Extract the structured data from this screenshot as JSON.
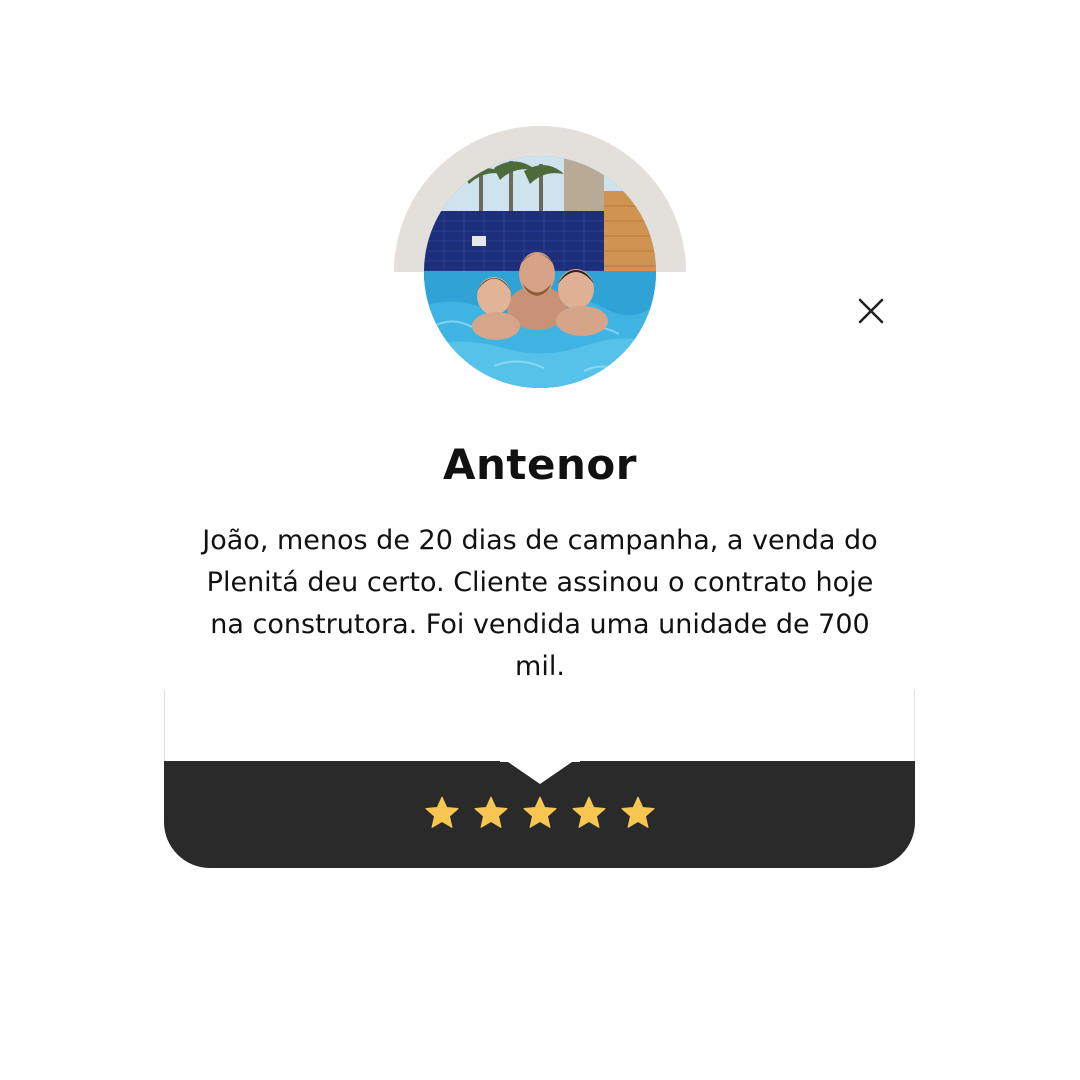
{
  "testimonial": {
    "name": "Antenor",
    "review_text": "João, menos de 20 dias de campanha, a venda do Plenitá deu certo. Cliente assinou o contrato hoje na construtora. Foi vendida uma unidade de 700 mil.",
    "rating": 5,
    "rating_max": 5
  },
  "icons": {
    "close": "close-icon",
    "star": "star-icon"
  },
  "colors": {
    "footer": "#2a2a2a",
    "star": "#f7c652",
    "arc": "#e3e0dc",
    "text": "#111111"
  }
}
